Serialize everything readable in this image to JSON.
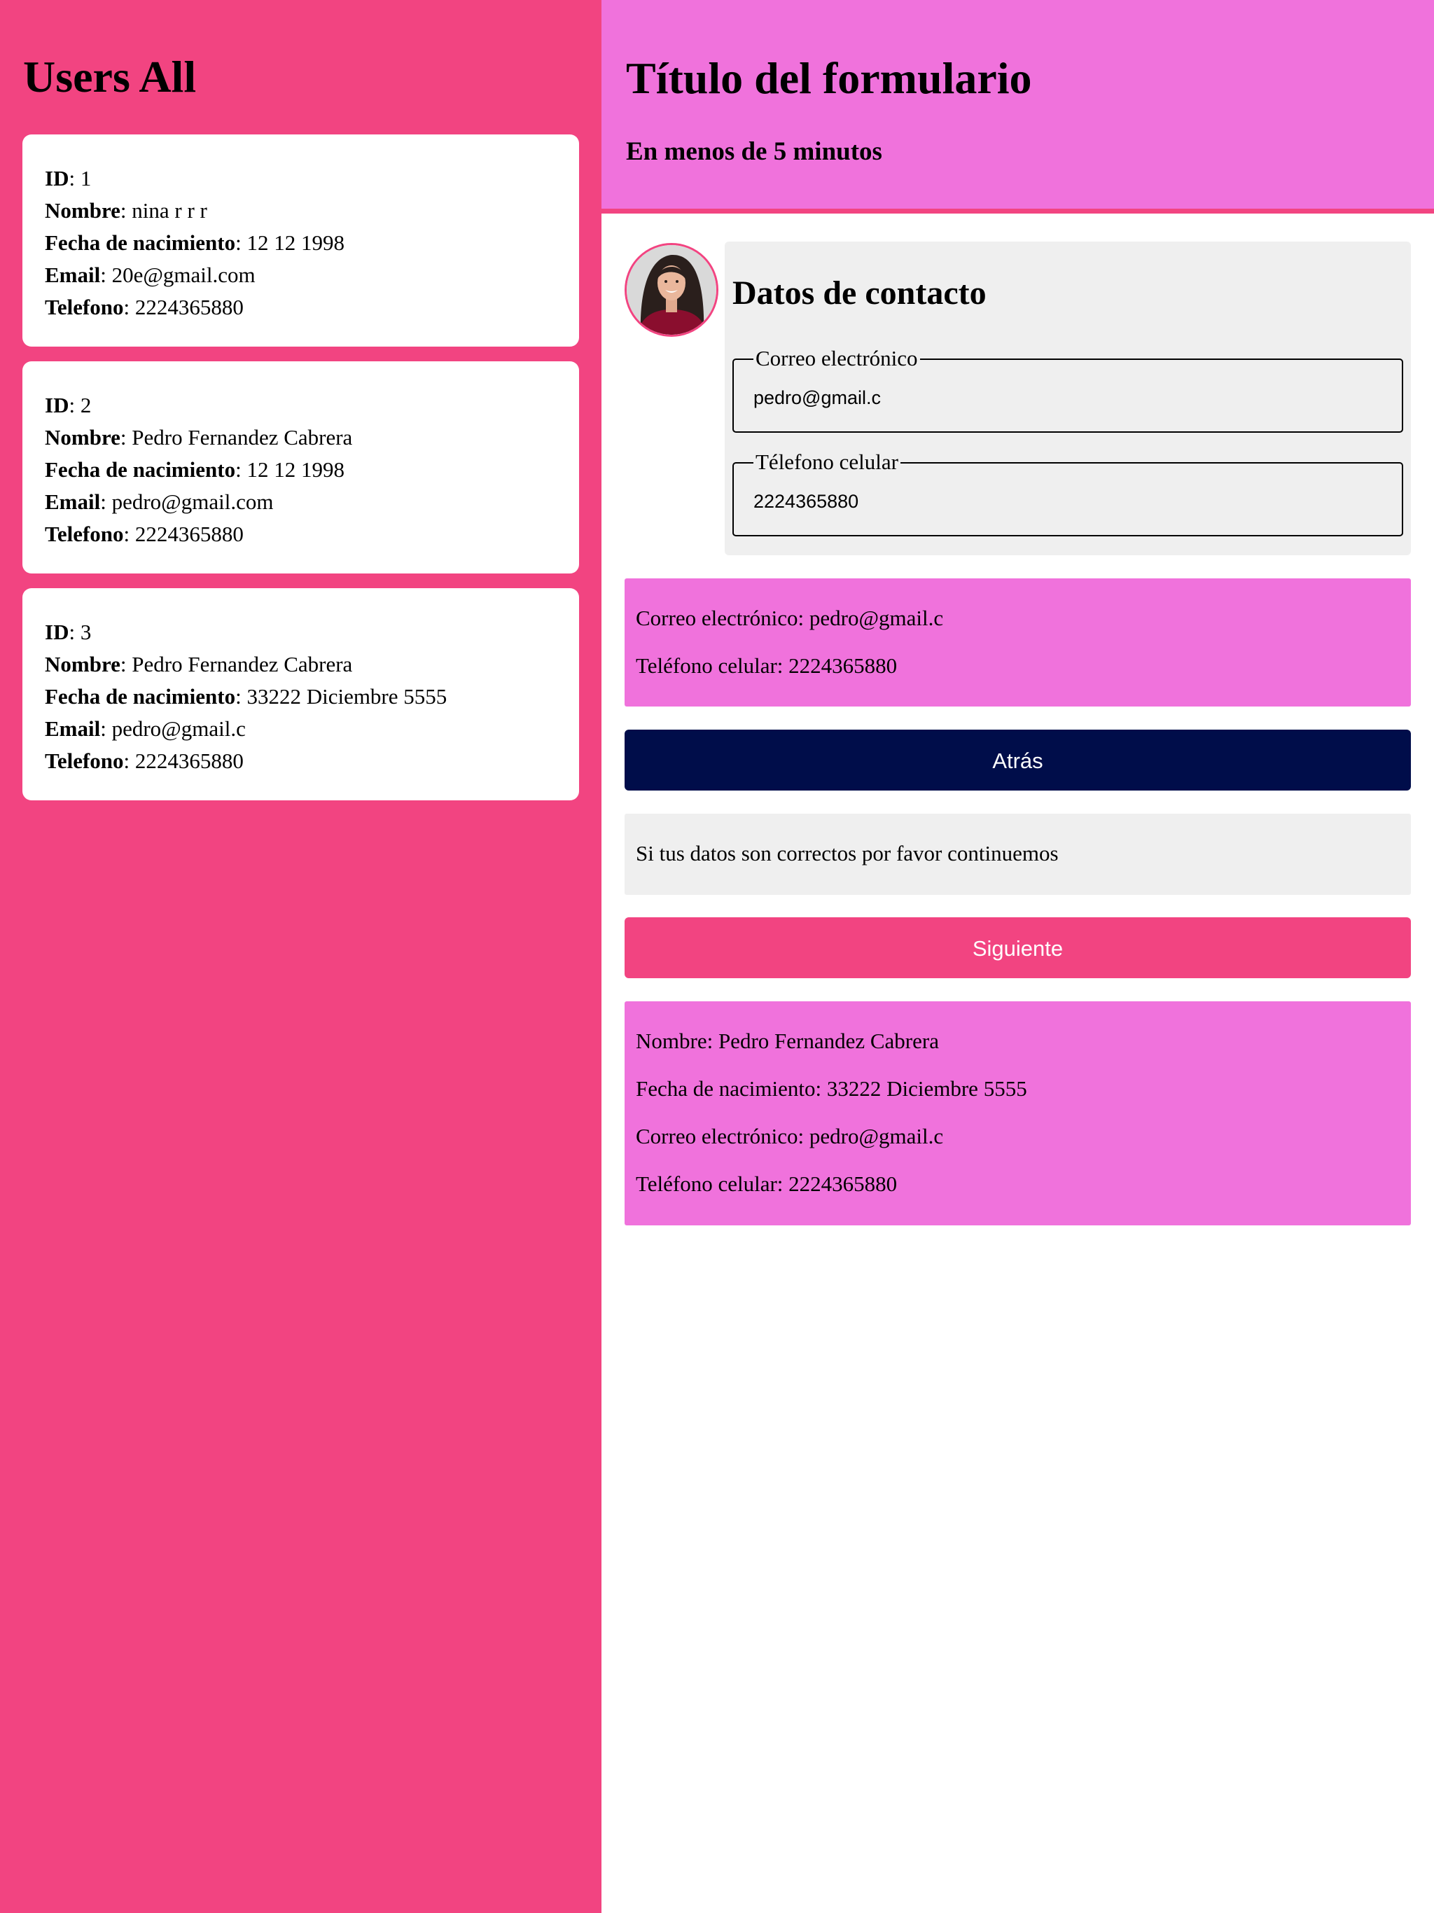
{
  "users_panel": {
    "title": "Users All",
    "field_labels": {
      "id": "ID",
      "name": "Nombre",
      "birth": "Fecha de nacimiento",
      "email": "Email",
      "phone": "Telefono"
    },
    "users": [
      {
        "id": ": 1",
        "name": ": nina r r r",
        "birth": ": 12 12 1998",
        "email": ": 20e@gmail.com",
        "phone": ": 2224365880"
      },
      {
        "id": ": 2",
        "name": ": Pedro Fernandez Cabrera",
        "birth": ": 12 12 1998",
        "email": ": pedro@gmail.com",
        "phone": ": 2224365880"
      },
      {
        "id": ": 3",
        "name": ": Pedro Fernandez Cabrera",
        "birth": ": 33222 Diciembre 5555",
        "email": ": pedro@gmail.c",
        "phone": ": 2224365880"
      }
    ]
  },
  "form": {
    "title": "Título del formulario",
    "subtitle": "En menos de 5 minutos",
    "contact": {
      "title": "Datos de contacto",
      "email_legend": "Correo electrónico",
      "email_value": "pedro@gmail.c",
      "phone_legend": "Télefono celular",
      "phone_value": "2224365880"
    },
    "contact_summary": {
      "email": "Correo electrónico: pedro@gmail.c",
      "phone": "Teléfono celular: 2224365880"
    },
    "back_button": "Atrás",
    "note": "Si tus datos son correctos por favor continuemos",
    "next_button": "Siguiente",
    "final_summary": {
      "name": "Nombre: Pedro Fernandez Cabrera",
      "birth": "Fecha de nacimiento: 33222 Diciembre 5555",
      "email": "Correo electrónico: pedro@gmail.c",
      "phone": "Teléfono celular: 2224365880"
    }
  },
  "colors": {
    "primary_pink": "#f24481",
    "light_magenta": "#f072dc",
    "navy": "#000d4a",
    "light_gray": "#efefef"
  },
  "icons": {
    "avatar": "user-avatar-photo"
  }
}
